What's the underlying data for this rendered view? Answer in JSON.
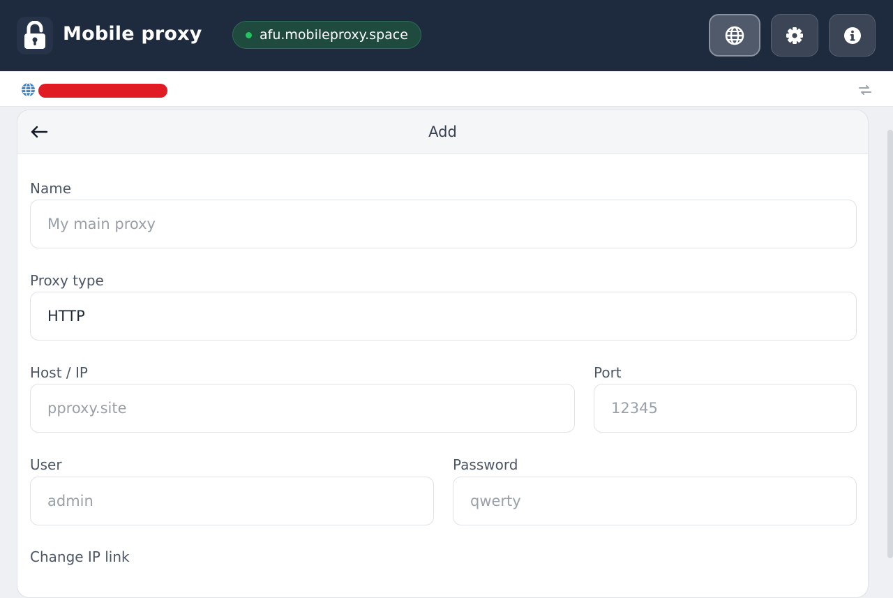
{
  "app": {
    "title": "Mobile proxy",
    "domain": "afu.mobileproxy.space"
  },
  "header": {
    "buttons": [
      {
        "icon": "globe-icon"
      },
      {
        "icon": "gear-icon"
      },
      {
        "icon": "info-icon"
      }
    ]
  },
  "form": {
    "title": "Add",
    "name": {
      "label": "Name",
      "placeholder": "My main proxy"
    },
    "proxy_type": {
      "label": "Proxy type",
      "value": "HTTP"
    },
    "host": {
      "label": "Host / IP",
      "placeholder": "pproxy.site"
    },
    "port": {
      "label": "Port",
      "placeholder": "12345"
    },
    "user": {
      "label": "User",
      "placeholder": "admin"
    },
    "password": {
      "label": "Password",
      "placeholder": "qwerty"
    },
    "change_ip": {
      "label": "Change IP link"
    }
  },
  "colors": {
    "header_bg": "#1e2a3e",
    "status_dot": "#22c55e",
    "redaction": "#e01b24"
  }
}
